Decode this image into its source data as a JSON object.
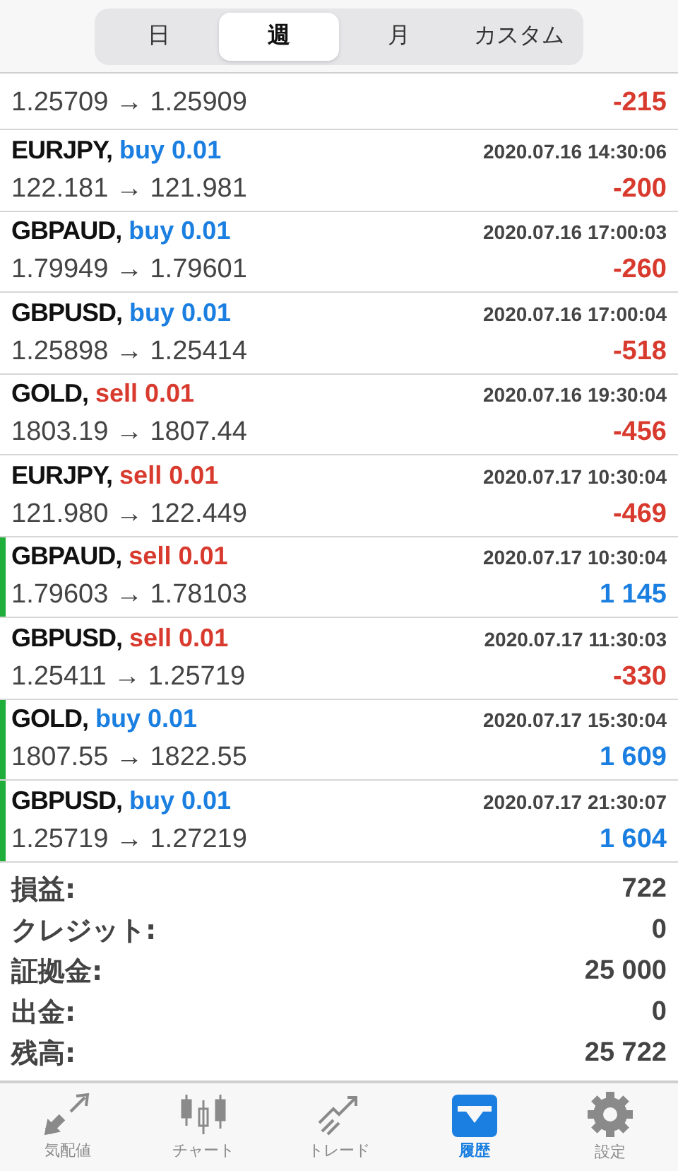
{
  "period_tabs": [
    {
      "label": "日",
      "selected": false
    },
    {
      "label": "週",
      "selected": true
    },
    {
      "label": "月",
      "selected": false
    },
    {
      "label": "カスタム",
      "selected": false
    }
  ],
  "partial_deal": {
    "prices": "1.25709 → 1.25909",
    "profit": "-215",
    "loss": true
  },
  "deals": [
    {
      "symbol": "EURJPY,",
      "order": "buy 0.01",
      "sell": false,
      "time": "2020.07.16 14:30:06",
      "prices": "122.181 → 121.981",
      "profit": "-200",
      "loss": true
    },
    {
      "symbol": "GBPAUD,",
      "order": "buy 0.01",
      "sell": false,
      "time": "2020.07.16 17:00:03",
      "prices": "1.79949 → 1.79601",
      "profit": "-260",
      "loss": true
    },
    {
      "symbol": "GBPUSD,",
      "order": "buy 0.01",
      "sell": false,
      "time": "2020.07.16 17:00:04",
      "prices": "1.25898 → 1.25414",
      "profit": "-518",
      "loss": true
    },
    {
      "symbol": "GOLD,",
      "order": "sell 0.01",
      "sell": true,
      "time": "2020.07.16 19:30:04",
      "prices": "1803.19 → 1807.44",
      "profit": "-456",
      "loss": true
    },
    {
      "symbol": "EURJPY,",
      "order": "sell 0.01",
      "sell": true,
      "time": "2020.07.17 10:30:04",
      "prices": "121.980 → 122.449",
      "profit": "-469",
      "loss": true
    },
    {
      "symbol": "GBPAUD,",
      "order": "sell 0.01",
      "sell": true,
      "time": "2020.07.17 10:30:04",
      "prices": "1.79603 → 1.78103",
      "profit": "1 145",
      "loss": false
    },
    {
      "symbol": "GBPUSD,",
      "order": "sell 0.01",
      "sell": true,
      "time": "2020.07.17 11:30:03",
      "prices": "1.25411 → 1.25719",
      "profit": "-330",
      "loss": true
    },
    {
      "symbol": "GOLD,",
      "order": "buy 0.01",
      "sell": false,
      "time": "2020.07.17 15:30:04",
      "prices": "1807.55 → 1822.55",
      "profit": "1 609",
      "loss": false
    },
    {
      "symbol": "GBPUSD,",
      "order": "buy 0.01",
      "sell": false,
      "time": "2020.07.17 21:30:07",
      "prices": "1.25719 → 1.27219",
      "profit": "1 604",
      "loss": false
    }
  ],
  "summary": [
    {
      "label": "損益:",
      "value": "722"
    },
    {
      "label": "クレジット:",
      "value": "0"
    },
    {
      "label": "証拠金:",
      "value": "25 000"
    },
    {
      "label": "出金:",
      "value": "0"
    },
    {
      "label": "残高:",
      "value": "25 722"
    }
  ],
  "bottom_tabs": [
    {
      "label": "気配値",
      "kind": "quotes",
      "selected": false
    },
    {
      "label": "チャート",
      "kind": "chart",
      "selected": false
    },
    {
      "label": "トレード",
      "kind": "trade",
      "selected": false
    },
    {
      "label": "履歴",
      "kind": "history",
      "selected": true
    },
    {
      "label": "設定",
      "kind": "settings",
      "selected": false
    }
  ]
}
